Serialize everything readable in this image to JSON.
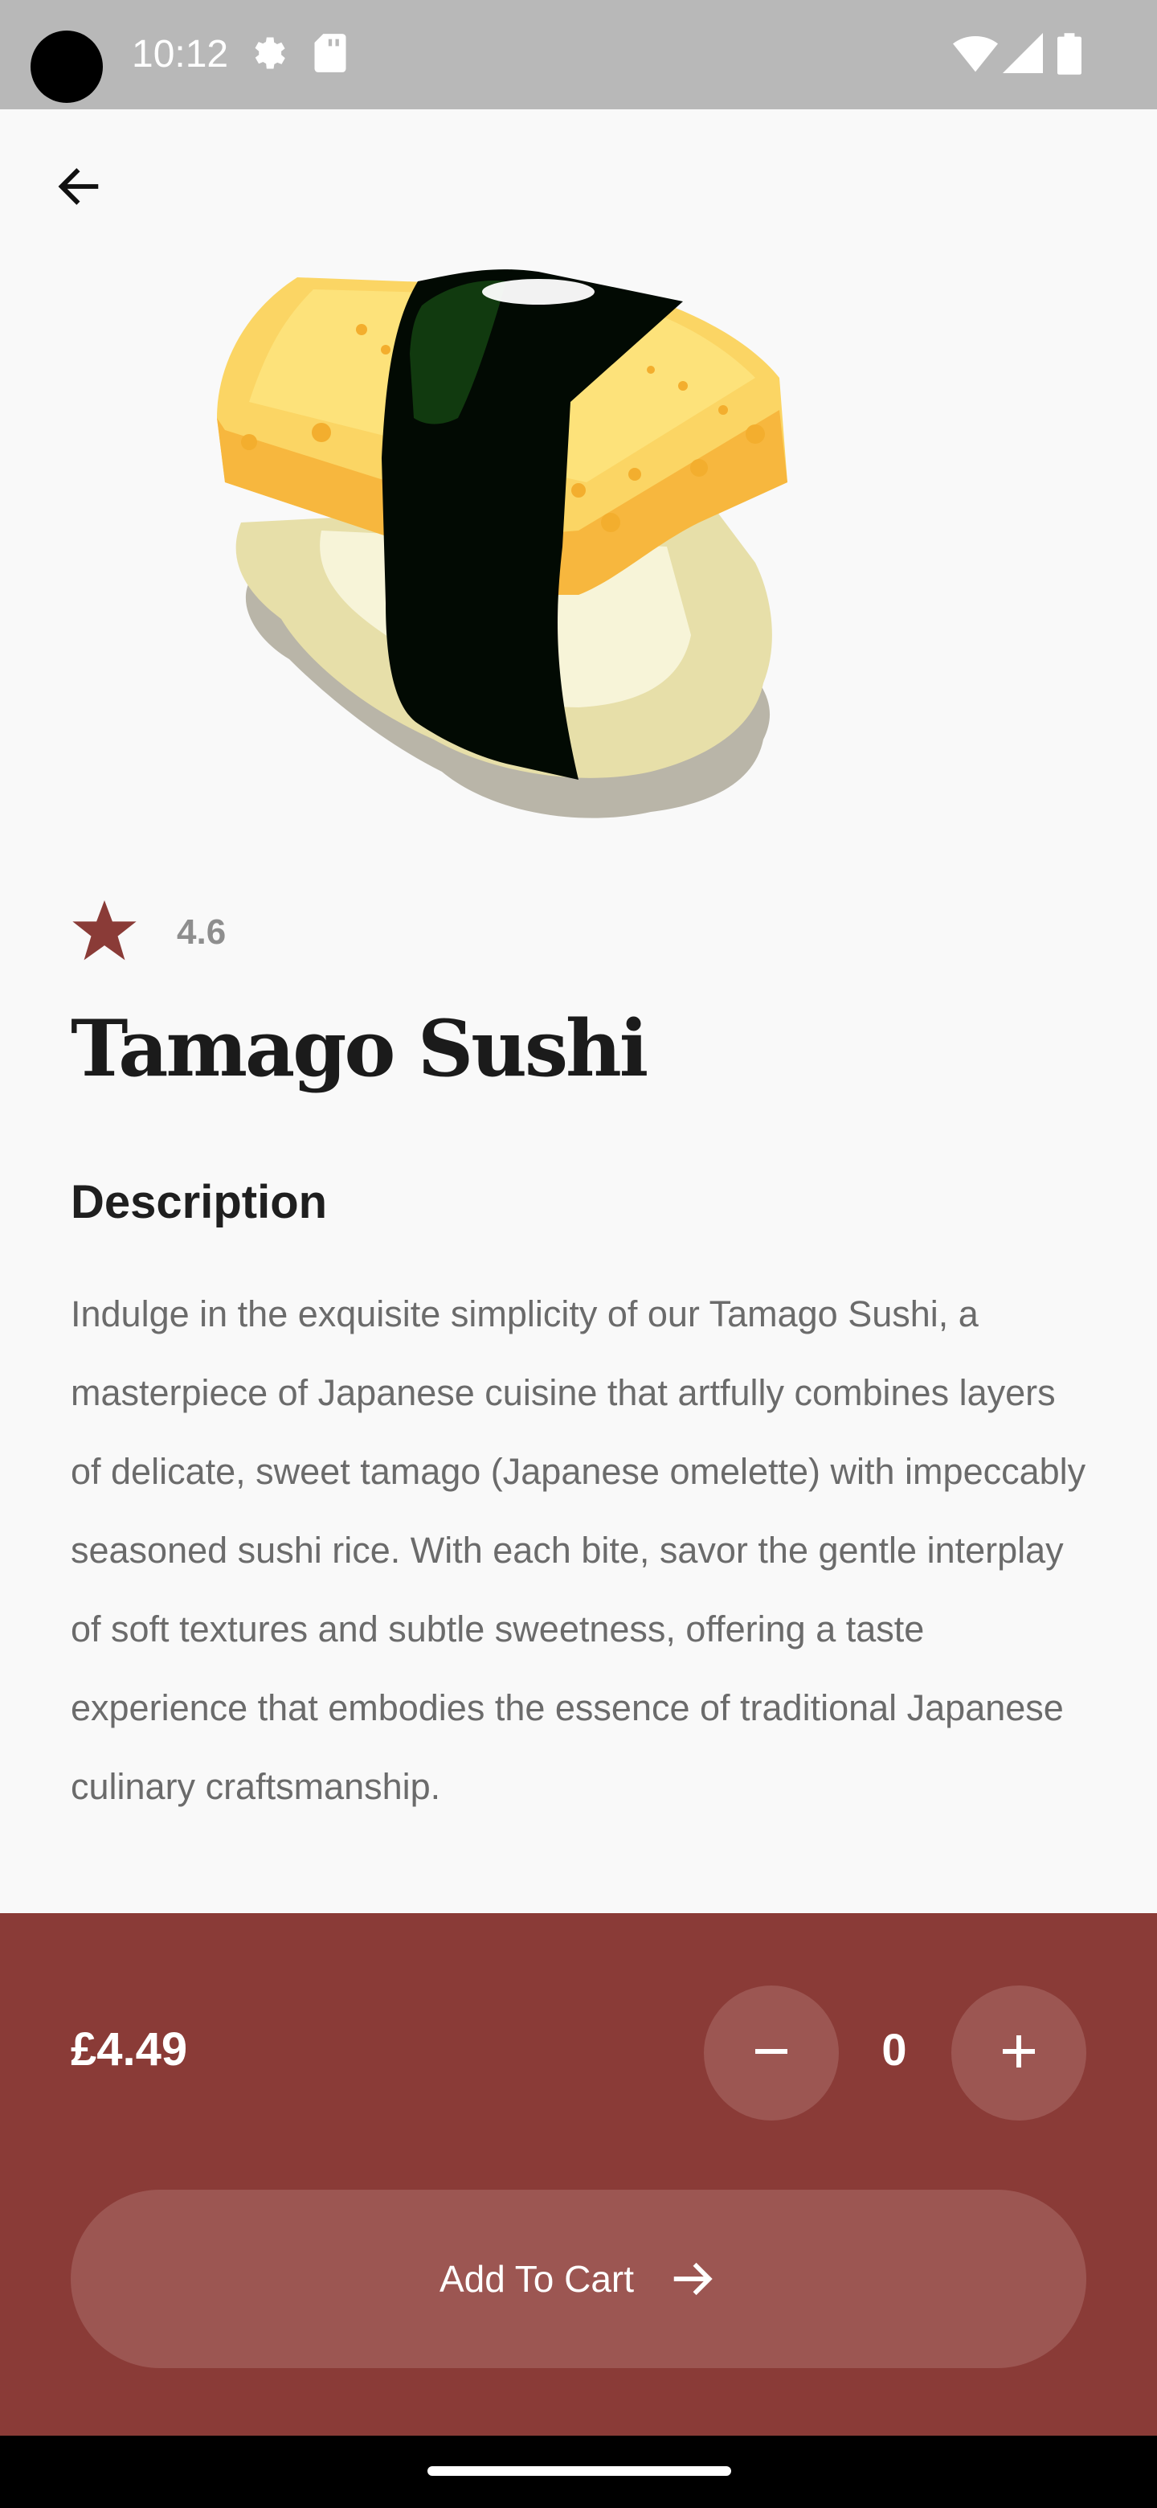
{
  "status_bar": {
    "time": "10:12",
    "icons": [
      "settings-icon",
      "sd-card-icon",
      "wifi-icon",
      "signal-icon",
      "battery-icon"
    ]
  },
  "header": {
    "back_icon": "arrow-left-icon"
  },
  "product": {
    "image": "tamago-sushi-illustration",
    "rating": "4.6",
    "rating_icon": "star-icon",
    "title": "Tamago Sushi",
    "description_heading": "Description",
    "description": "Indulge in the exquisite simplicity of our Tamago Sushi, a masterpiece of Japanese cuisine that artfully combines layers of delicate, sweet tamago (Japanese omelette) with impeccably seasoned sushi rice. With each bite, savor the gentle interplay of soft textures and subtle sweetness, offering a taste experience that embodies the essence of traditional Japanese culinary craftsmanship."
  },
  "cart": {
    "price": "£4.49",
    "quantity": "0",
    "decrement_icon": "minus-icon",
    "increment_icon": "plus-icon",
    "add_label": "Add To Cart",
    "add_icon": "arrow-right-icon"
  },
  "colors": {
    "accent": "#8a3b37",
    "accent_light": "#9c5652",
    "star": "#8a3b37",
    "background": "#f9f9f9",
    "status_bar": "#b8b8b8"
  }
}
